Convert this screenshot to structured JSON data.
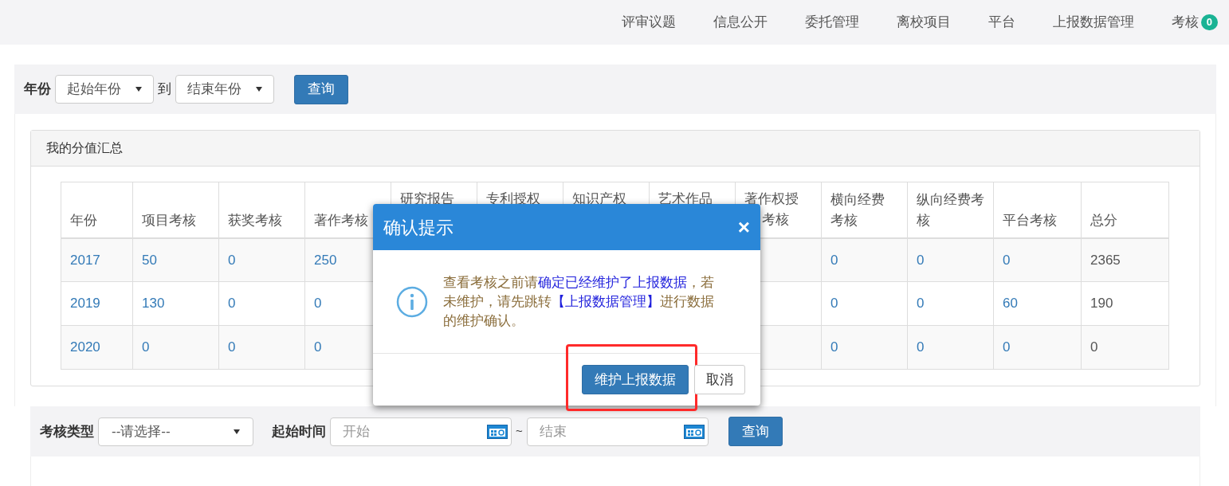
{
  "nav": {
    "items": [
      {
        "label": "评审议题"
      },
      {
        "label": "信息公开"
      },
      {
        "label": "委托管理"
      },
      {
        "label": "离校项目"
      },
      {
        "label": "平台"
      },
      {
        "label": "上报数据管理"
      },
      {
        "label": "考核",
        "badge": "0"
      }
    ]
  },
  "year_filter": {
    "label": "年份",
    "start": {
      "value": "起始年份"
    },
    "separator": "到",
    "end": {
      "value": "结束年份"
    },
    "button": "查询"
  },
  "summary": {
    "title": "我的分值汇总",
    "columns": [
      {
        "lines": [
          "年份"
        ],
        "covered": false,
        "linked": true
      },
      {
        "lines": [
          "项目考核"
        ],
        "covered": false,
        "linked": true
      },
      {
        "lines": [
          "获奖考核"
        ],
        "covered": false,
        "linked": true
      },
      {
        "lines": [
          "著作考核"
        ],
        "covered": false,
        "linked": true
      },
      {
        "lines": [
          "研究报告"
        ],
        "covered": true,
        "linked": true
      },
      {
        "lines": [
          "专利授权"
        ],
        "covered": true,
        "linked": true
      },
      {
        "lines": [
          "知识产权"
        ],
        "covered": true,
        "linked": true
      },
      {
        "lines": [
          "艺术作品"
        ],
        "covered": true,
        "linked": true
      },
      {
        "lines": [
          "著作权授",
          "考核"
        ],
        "covered": true,
        "linked": true
      },
      {
        "lines": [
          "横向经费",
          "考核"
        ],
        "covered": false,
        "linked": true
      },
      {
        "lines": [
          "纵向经费考",
          "核"
        ],
        "covered": false,
        "linked": true
      },
      {
        "lines": [
          "平台考核"
        ],
        "covered": false,
        "linked": true
      },
      {
        "lines": [
          "总分"
        ],
        "covered": false,
        "linked": false
      }
    ],
    "rows": [
      {
        "cells": [
          "2017",
          "50",
          "0",
          "250",
          "0",
          "0",
          "0",
          "2365"
        ]
      },
      {
        "cells": [
          "2019",
          "130",
          "0",
          "0",
          "0",
          "0",
          "60",
          "190"
        ]
      },
      {
        "cells": [
          "2020",
          "0",
          "0",
          "0",
          "0",
          "0",
          "0",
          "0"
        ]
      }
    ]
  },
  "dialog": {
    "title": "确认提示",
    "close": "×",
    "message": [
      {
        "text": "查看考核之前请",
        "emphasis": false
      },
      {
        "text": "确定已经维护了上报数据",
        "emphasis": true
      },
      {
        "text": "，若未维护，请先跳转",
        "emphasis": false
      },
      {
        "text": "【上报数据管理】",
        "emphasis": true
      },
      {
        "text": "进行数据的维护确认。",
        "emphasis": false
      }
    ],
    "buttons": [
      {
        "label": "维护上报数据",
        "kind": "primary",
        "highlighted": true
      },
      {
        "label": "取消",
        "kind": "default",
        "highlighted": false
      }
    ]
  },
  "search": {
    "type_label": "考核类型",
    "type_value": "--请选择--",
    "time_label": "起始时间",
    "start_placeholder": "开始",
    "separator": "~",
    "end_placeholder": "结束",
    "button": "查询"
  }
}
